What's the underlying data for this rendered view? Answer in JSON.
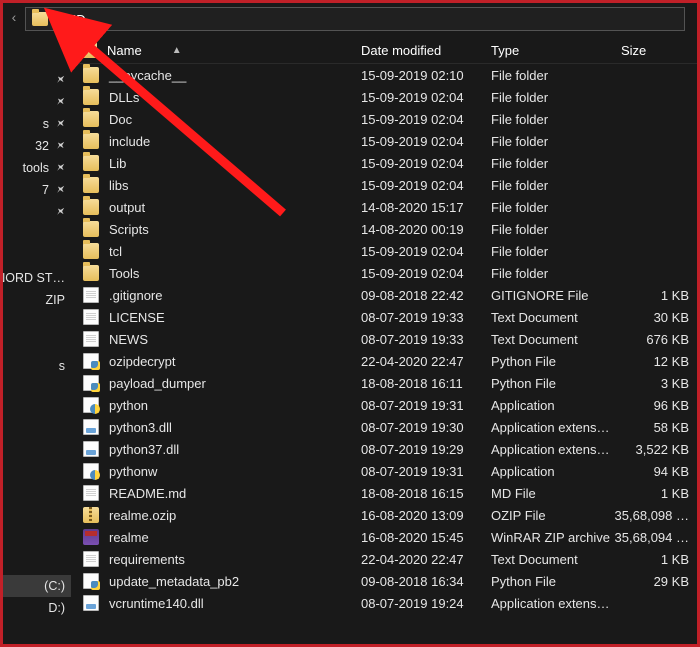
{
  "addressbar": {
    "value": "CMD"
  },
  "nav": {
    "items": [
      {
        "label": "",
        "pin": false,
        "kind": "spacer"
      },
      {
        "label": "",
        "pin": true,
        "kind": "quick"
      },
      {
        "label": "",
        "pin": true,
        "kind": "quick"
      },
      {
        "label": "s",
        "pin": true,
        "kind": "quick"
      },
      {
        "label": "32",
        "pin": true,
        "kind": "quick"
      },
      {
        "label": "tools",
        "pin": true,
        "kind": "quick"
      },
      {
        "label": "7",
        "pin": true,
        "kind": "quick"
      },
      {
        "label": "",
        "pin": true,
        "kind": "quick"
      },
      {
        "label": "",
        "pin": false,
        "kind": "spacer"
      },
      {
        "label": "",
        "pin": false,
        "kind": "spacer"
      },
      {
        "label": "NORD ST…",
        "pin": false,
        "kind": "item"
      },
      {
        "label": "ZIP",
        "pin": false,
        "kind": "item"
      },
      {
        "label": "",
        "pin": false,
        "kind": "spacer"
      },
      {
        "label": "",
        "pin": false,
        "kind": "spacer"
      },
      {
        "label": "s",
        "pin": false,
        "kind": "item"
      },
      {
        "label": "",
        "pin": false,
        "kind": "spacer"
      },
      {
        "label": "",
        "pin": false,
        "kind": "spacer"
      },
      {
        "label": "",
        "pin": false,
        "kind": "spacer"
      },
      {
        "label": "",
        "pin": false,
        "kind": "spacer"
      },
      {
        "label": "",
        "pin": false,
        "kind": "spacer"
      },
      {
        "label": "",
        "pin": false,
        "kind": "spacer"
      },
      {
        "label": "",
        "pin": false,
        "kind": "spacer"
      },
      {
        "label": "",
        "pin": false,
        "kind": "spacer"
      },
      {
        "label": "",
        "pin": false,
        "kind": "spacer"
      },
      {
        "label": "(C:)",
        "pin": false,
        "kind": "item",
        "selected": true
      },
      {
        "label": "D:)",
        "pin": false,
        "kind": "item"
      }
    ]
  },
  "columns": {
    "name": "Name",
    "date": "Date modified",
    "type": "Type",
    "size": "Size"
  },
  "rows": [
    {
      "icon": "folder",
      "name": "__pycache__",
      "date": "15-09-2019 02:10",
      "type": "File folder",
      "size": ""
    },
    {
      "icon": "folder",
      "name": "DLLs",
      "date": "15-09-2019 02:04",
      "type": "File folder",
      "size": ""
    },
    {
      "icon": "folder",
      "name": "Doc",
      "date": "15-09-2019 02:04",
      "type": "File folder",
      "size": ""
    },
    {
      "icon": "folder",
      "name": "include",
      "date": "15-09-2019 02:04",
      "type": "File folder",
      "size": ""
    },
    {
      "icon": "folder",
      "name": "Lib",
      "date": "15-09-2019 02:04",
      "type": "File folder",
      "size": ""
    },
    {
      "icon": "folder",
      "name": "libs",
      "date": "15-09-2019 02:04",
      "type": "File folder",
      "size": ""
    },
    {
      "icon": "folder",
      "name": "output",
      "date": "14-08-2020 15:17",
      "type": "File folder",
      "size": ""
    },
    {
      "icon": "folder",
      "name": "Scripts",
      "date": "14-08-2020 00:19",
      "type": "File folder",
      "size": ""
    },
    {
      "icon": "folder",
      "name": "tcl",
      "date": "15-09-2019 02:04",
      "type": "File folder",
      "size": ""
    },
    {
      "icon": "folder",
      "name": "Tools",
      "date": "15-09-2019 02:04",
      "type": "File folder",
      "size": ""
    },
    {
      "icon": "file",
      "name": ".gitignore",
      "date": "09-08-2018 22:42",
      "type": "GITIGNORE File",
      "size": "1 KB"
    },
    {
      "icon": "file",
      "name": "LICENSE",
      "date": "08-07-2019 19:33",
      "type": "Text Document",
      "size": "30 KB"
    },
    {
      "icon": "file",
      "name": "NEWS",
      "date": "08-07-2019 19:33",
      "type": "Text Document",
      "size": "676 KB"
    },
    {
      "icon": "py",
      "name": "ozipdecrypt",
      "date": "22-04-2020 22:47",
      "type": "Python File",
      "size": "12 KB"
    },
    {
      "icon": "py",
      "name": "payload_dumper",
      "date": "18-08-2018 16:11",
      "type": "Python File",
      "size": "3 KB"
    },
    {
      "icon": "exe",
      "name": "python",
      "date": "08-07-2019 19:31",
      "type": "Application",
      "size": "96 KB"
    },
    {
      "icon": "dll",
      "name": "python3.dll",
      "date": "08-07-2019 19:30",
      "type": "Application extens…",
      "size": "58 KB"
    },
    {
      "icon": "dll",
      "name": "python37.dll",
      "date": "08-07-2019 19:29",
      "type": "Application extens…",
      "size": "3,522 KB"
    },
    {
      "icon": "exe",
      "name": "pythonw",
      "date": "08-07-2019 19:31",
      "type": "Application",
      "size": "94 KB"
    },
    {
      "icon": "file",
      "name": "README.md",
      "date": "18-08-2018 16:15",
      "type": "MD File",
      "size": "1 KB"
    },
    {
      "icon": "zip",
      "name": "realme.ozip",
      "date": "16-08-2020 13:09",
      "type": "OZIP File",
      "size": "35,68,098 …"
    },
    {
      "icon": "rar",
      "name": "realme",
      "date": "16-08-2020 15:45",
      "type": "WinRAR ZIP archive",
      "size": "35,68,094 …"
    },
    {
      "icon": "file",
      "name": "requirements",
      "date": "22-04-2020 22:47",
      "type": "Text Document",
      "size": "1 KB"
    },
    {
      "icon": "py",
      "name": "update_metadata_pb2",
      "date": "09-08-2018 16:34",
      "type": "Python File",
      "size": "29 KB"
    },
    {
      "icon": "dll",
      "name": "vcruntime140.dll",
      "date": "08-07-2019 19:24",
      "type": "Application extens…",
      "size": ""
    }
  ]
}
